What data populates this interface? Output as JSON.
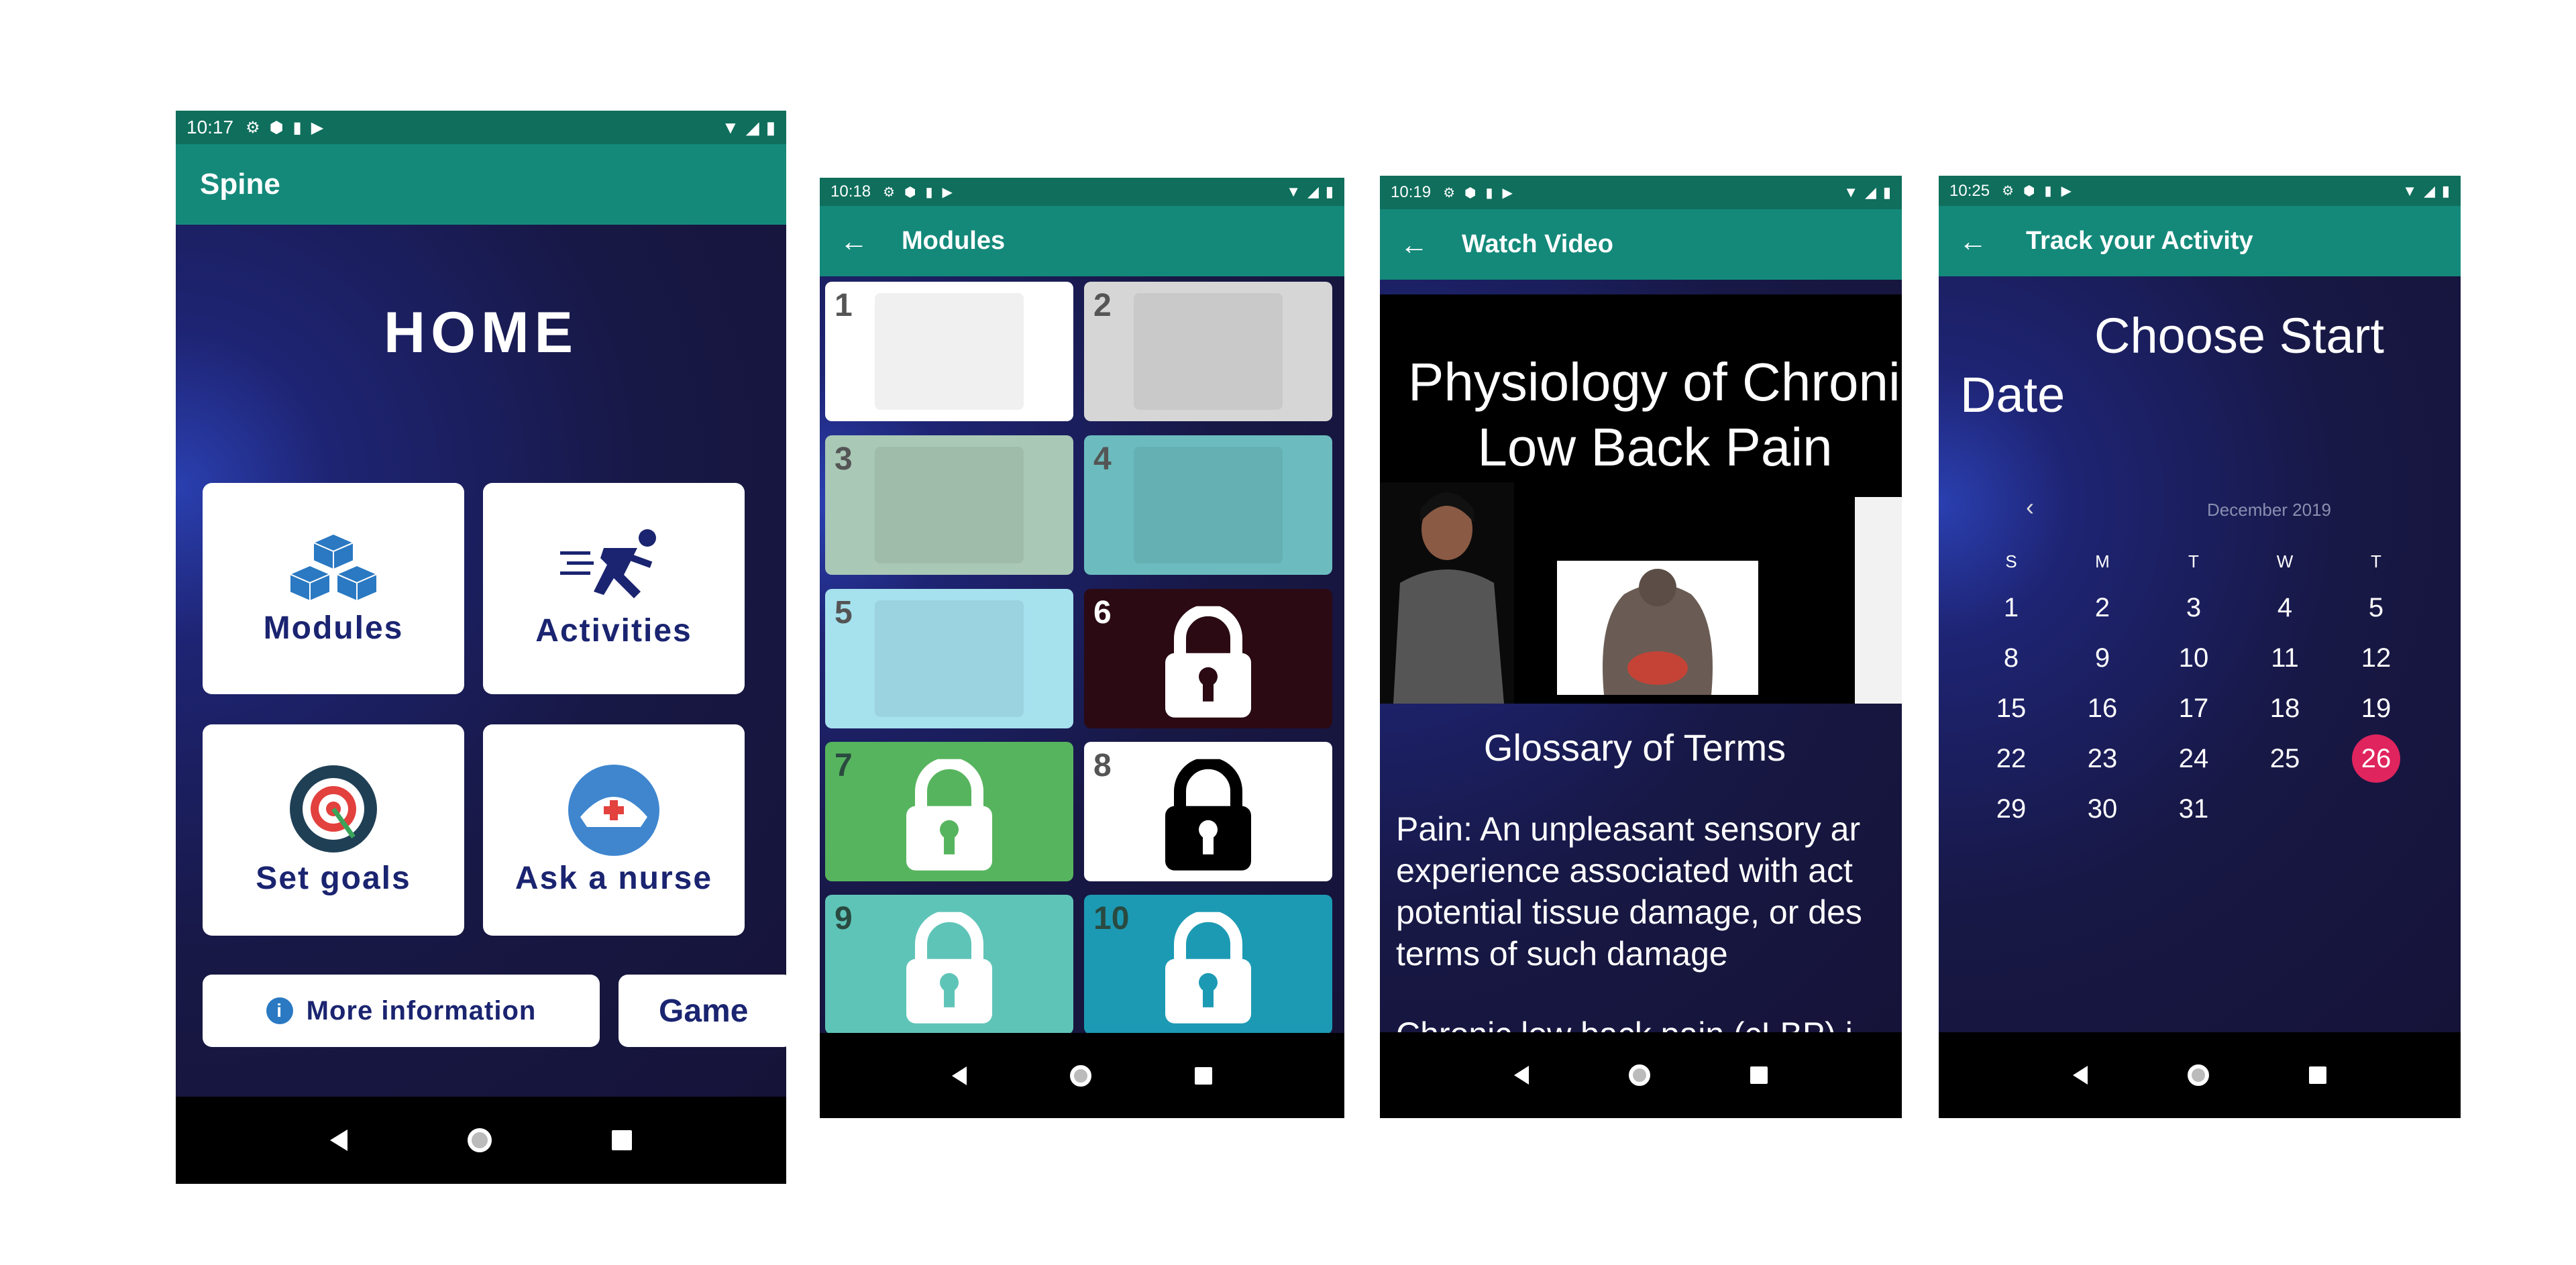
{
  "home": {
    "status_time": "10:17",
    "app_title": "Spine",
    "heading": "HOME",
    "cards": [
      {
        "label": "Modules",
        "icon": "cubes-icon"
      },
      {
        "label": "Activities",
        "icon": "running-person-icon"
      },
      {
        "label": "Set goals",
        "icon": "target-icon"
      },
      {
        "label": "Ask a nurse",
        "icon": "nurse-cap-icon"
      }
    ],
    "more_info_label": "More information",
    "game_label": "Game"
  },
  "modules": {
    "status_time": "10:18",
    "title": "Modules",
    "tiles": [
      {
        "num": "1",
        "locked": false,
        "bg": "#ffffff"
      },
      {
        "num": "2",
        "locked": false,
        "bg": "#d6d6d6"
      },
      {
        "num": "3",
        "locked": false,
        "bg": "#a9c8b6"
      },
      {
        "num": "4",
        "locked": false,
        "bg": "#6cbcbf"
      },
      {
        "num": "5",
        "locked": false,
        "bg": "#a6e1ee"
      },
      {
        "num": "6",
        "locked": true,
        "bg": "#2b0a14"
      },
      {
        "num": "7",
        "locked": true,
        "bg": "#57b45e"
      },
      {
        "num": "8",
        "locked": true,
        "bg": "#ffffff"
      },
      {
        "num": "9",
        "locked": true,
        "bg": "#5fc4b8"
      },
      {
        "num": "10",
        "locked": true,
        "bg": "#1c9ab4"
      }
    ]
  },
  "video": {
    "status_time": "10:19",
    "title": "Watch Video",
    "video_title_line1": "Physiology of Chronic",
    "video_title_line2": "Low Back Pain",
    "glossary_heading": "Glossary of Terms",
    "glossary_lines": [
      "Pain: An unpleasant sensory ar",
      "experience associated with act",
      "potential tissue damage, or des",
      "terms of such damage"
    ],
    "cut_line": "Chronic low back pain (cLBP) i"
  },
  "activity": {
    "status_time": "10:25",
    "title": "Track your Activity",
    "heading_line1": "Choose Start",
    "heading_line2": "Date",
    "month_label": "December 2019",
    "weekdays": [
      "S",
      "M",
      "T",
      "W",
      "T"
    ],
    "weeks": [
      [
        "1",
        "2",
        "3",
        "4",
        "5"
      ],
      [
        "8",
        "9",
        "10",
        "11",
        "12"
      ],
      [
        "15",
        "16",
        "17",
        "18",
        "19"
      ],
      [
        "22",
        "23",
        "24",
        "25",
        "26"
      ],
      [
        "29",
        "30",
        "31",
        "",
        ""
      ]
    ],
    "selected_day": "26",
    "accent": "#e0245e"
  },
  "colors": {
    "status_bar": "#0f6e5c",
    "app_bar": "#14897a",
    "text_navy": "#1a2470"
  }
}
